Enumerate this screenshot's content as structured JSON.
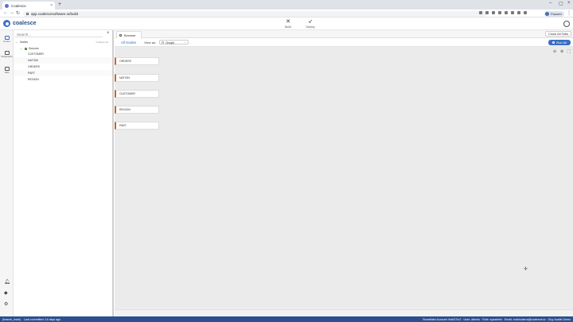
{
  "browser": {
    "tab_title": "Coalesce",
    "new_tab": "+",
    "url": "app.coalescesoftware.io/build",
    "profile_label": "Paused"
  },
  "app": {
    "logo_text": "coalesce",
    "nav": [
      {
        "label": "Build",
        "icon": "wrench-icon"
      },
      {
        "label": "Deploy",
        "icon": "rocket-icon"
      }
    ]
  },
  "rail": {
    "items": [
      {
        "label": "Nodes"
      },
      {
        "label": "Subgraphs"
      },
      {
        "label": "Jobs"
      }
    ]
  },
  "sidebar": {
    "search_placeholder": "Search...",
    "add": "+",
    "tree_root": "Nodes",
    "collapse_all": "Collapse All",
    "group": "Sources",
    "items": [
      "CUSTOMER",
      "NATION",
      "ORDERS",
      "PART",
      "REGION"
    ]
  },
  "main": {
    "tab_label": "Browser",
    "close_all": "Close All Tabs",
    "all_nodes": "All Nodes",
    "view_as": "View as:",
    "view_value": "Graph",
    "run_all": "Run All",
    "graph_nodes": [
      "ORDERS",
      "NATION",
      "CUSTOMER",
      "REGION",
      "PART"
    ]
  },
  "status": {
    "branch": "(branch_main)",
    "last_committed": "Last committed: 14 days ago",
    "account": "Snowflake Account: lbdd17m2 · User: alberto · Role: sysadmin",
    "email": "Email: rodnicolarra@coalesce.io · Org: Austin Demo"
  }
}
